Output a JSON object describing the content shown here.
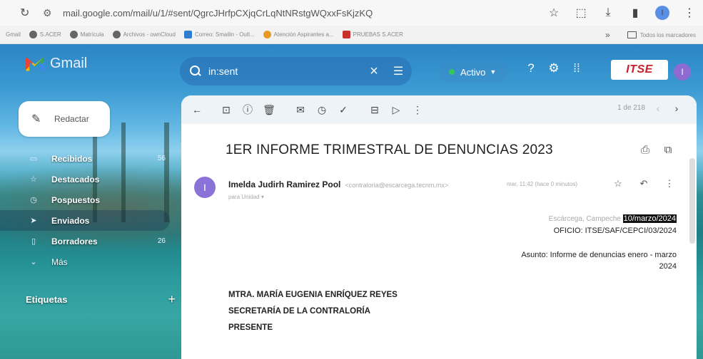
{
  "browser": {
    "url": "mail.google.com/mail/u/1/#sent/QgrcJHrfpCXjqCrLqNtNRstgWQxxFsKjzKQ",
    "bookmarks": [
      {
        "label": "Gmail",
        "icon": "mail-icon"
      },
      {
        "label": "S.ACER",
        "icon": "globe-icon"
      },
      {
        "label": "Matrícula",
        "icon": "globe-icon"
      },
      {
        "label": "Archivos - ownCloud",
        "icon": "globe-icon"
      },
      {
        "label": "Correo: Smailin - Outl...",
        "icon": "outlook-icon"
      },
      {
        "label": "Atención Aspirantes a...",
        "icon": "orange-circle-icon"
      },
      {
        "label": "PRUEBAS S.ACER",
        "icon": "red-icon"
      }
    ],
    "bookmarks_overflow": "»",
    "all_bookmarks_label": "Todos los marcadores",
    "profile_initial": "I"
  },
  "gmail": {
    "logo_text": "Gmail",
    "search_query": "in:sent",
    "status_label": "Activo",
    "brand_text": "ITSE",
    "avatar_initial": "I",
    "compose_label": "Redactar",
    "nav": [
      {
        "label": "Recibidos",
        "count": "56",
        "icon": "inbox-icon"
      },
      {
        "label": "Destacados",
        "count": "",
        "icon": "star-icon"
      },
      {
        "label": "Pospuestos",
        "count": "",
        "icon": "clock-icon"
      },
      {
        "label": "Enviados",
        "count": "",
        "icon": "send-icon"
      },
      {
        "label": "Borradores",
        "count": "26",
        "icon": "draft-icon"
      },
      {
        "label": "Más",
        "count": "",
        "icon": "chevron-down-icon"
      }
    ],
    "labels_title": "Etiquetas",
    "pager": "1 de 218"
  },
  "email": {
    "subject": "1ER INFORME TRIMESTRAL DE DENUNCIAS 2023",
    "sender_initial": "I",
    "sender_name": "Imelda Judirh Ramirez Pool",
    "sender_email": "<contraloria@escarcega.tecnm.mx>",
    "time": "mar, 11:42 (hace 0 minutos)",
    "to": "para Unidad",
    "place": "Escárcega, Campeche",
    "date": "10/marzo/2024",
    "oficio": "OFICIO: ITSE/SAF/CEPCI/03/2024",
    "asunto": "Asunto:  Informe de denuncias enero - marzo 2024",
    "addressee_1": "MTRA. MARÍA EUGENIA ENRÍQUEZ REYES",
    "addressee_2": "SECRETARÍA DE LA CONTRALORÍA",
    "addressee_3": "PRESENTE"
  }
}
